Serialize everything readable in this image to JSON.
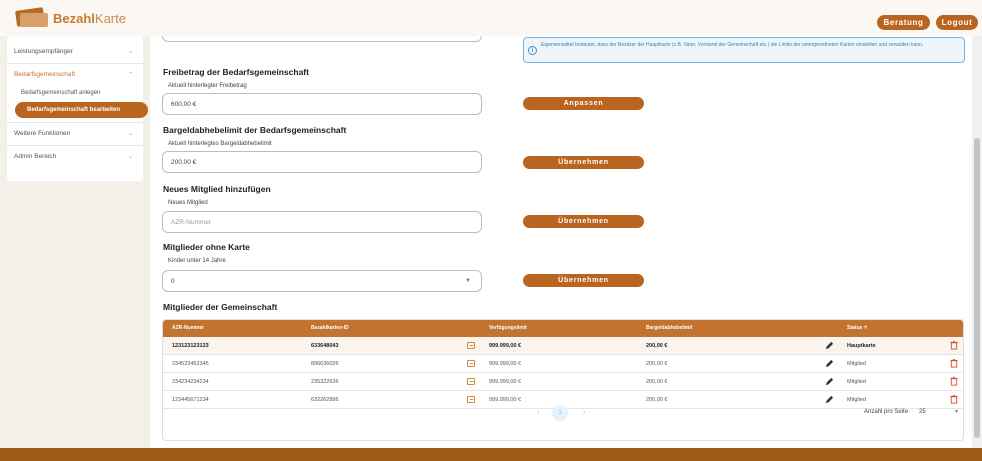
{
  "app": {
    "logo_main": "Bezahl",
    "logo_light": "Karte",
    "btn_beratung": "Beratung",
    "btn_logout": "Logout"
  },
  "sidebar": {
    "items": [
      {
        "label": "Leistungsempfänger"
      },
      {
        "label": "Bedarfsgemeinschaft"
      },
      {
        "label": "Weitere Funktionen"
      },
      {
        "label": "Admin Bereich"
      }
    ],
    "subitems": [
      {
        "label": "Bedarfsgemeinschaft anlegen"
      },
      {
        "label": "Bedarfsgemeinschaft bearbeiten"
      }
    ]
  },
  "info": {
    "text": "Eigenverwaltet bedeutet, dass der Besitzer der Hauptkarte (z.B. Vater, Vorstand der Gemeinschaft etc.) die Limits der untergeordneten Karten einstellen und verwalten kann."
  },
  "freibetrag": {
    "title": "Freibetrag der Bedarfsgemeinschaft",
    "label": "Aktuell hinterlegter Freibetrag",
    "value": "600,00 €",
    "button": "Anpassen"
  },
  "bargeld": {
    "title": "Bargeldabhebelimit der Bedarfsgemeinschaft",
    "label": "Aktuell hinterlegtes Bargeldabhebelimit",
    "value": "200,00 €",
    "button": "Übernehmen"
  },
  "mitglied": {
    "title": "Neues Mitglied hinzufügen",
    "label": "Neues Mitglied",
    "placeholder": "AZR-Nummer",
    "button": "Übernehmen"
  },
  "ohne_karte": {
    "title": "Mitglieder ohne Karte",
    "label": "Kinder unter 14 Jahre",
    "value": "0",
    "button": "Übernehmen"
  },
  "members": {
    "title": "Mitglieder der Gemeinschaft",
    "headers": [
      "AZR-Nummer",
      "Bezahlkarten-ID",
      "Verfügungslimit",
      "Bargeldabhebelimit",
      "Status"
    ],
    "sort_icon": "arrow-up-icon",
    "rows": [
      {
        "azr": "123123123123",
        "card_id": "633648043",
        "limit": "999.999,00 €",
        "cash": "200,00 €",
        "status": "Hauptkarte"
      },
      {
        "azr": "234523452345",
        "card_id": "896636026",
        "limit": "999.999,00 €",
        "cash": "200,00 €",
        "status": "Mitglied"
      },
      {
        "azr": "234234234234",
        "card_id": "235322636",
        "limit": "999.999,00 €",
        "cash": "200,00 €",
        "status": "Mitglied"
      },
      {
        "azr": "123445671234",
        "card_id": "632262886",
        "limit": "999.999,00 €",
        "cash": "200,00 €",
        "status": "Mitglied"
      }
    ],
    "pagination": {
      "page": "1",
      "per_page_label": "Anzahl pro Seite",
      "per_page_value": "25"
    }
  },
  "colors": {
    "accent": "#b9651f",
    "table_header": "#c2732f",
    "footer": "#9e5a18",
    "info_border": "#72b7e6"
  }
}
